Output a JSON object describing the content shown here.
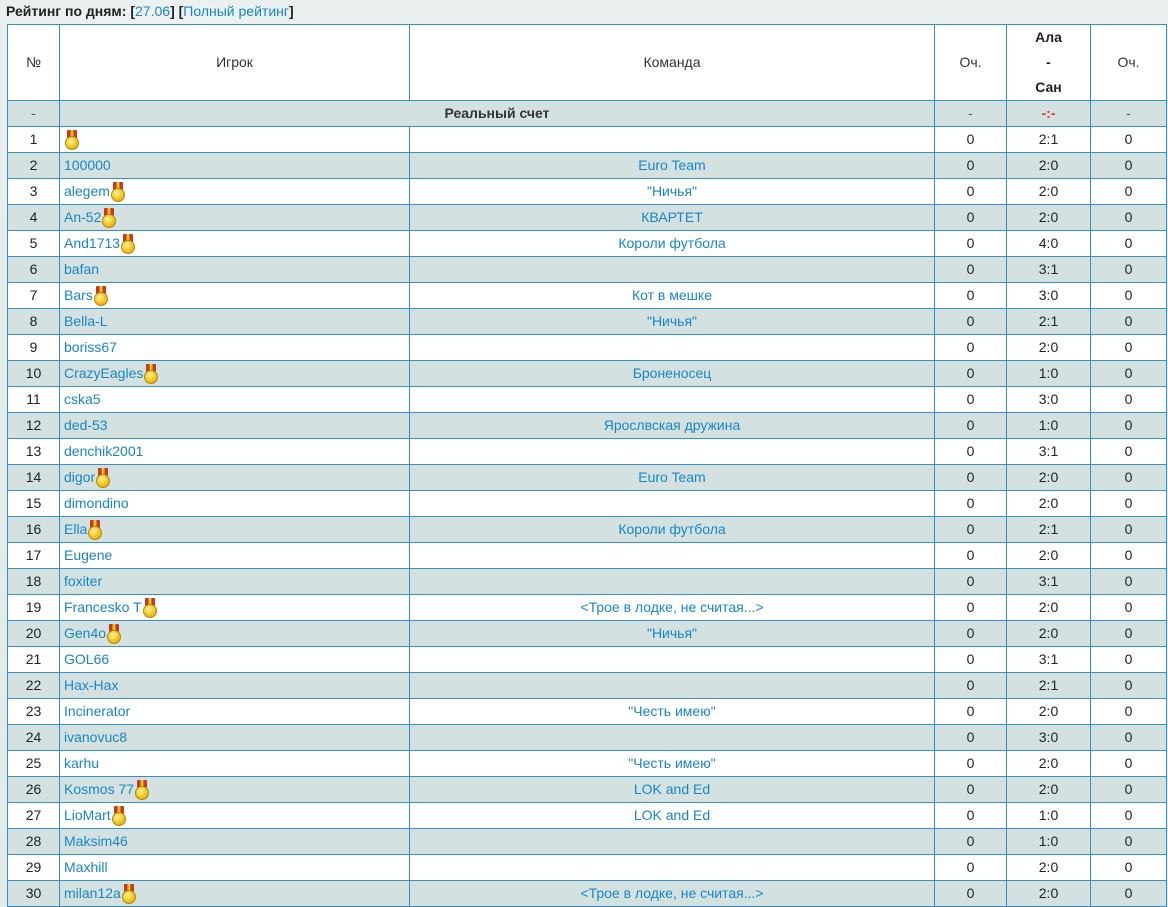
{
  "header": {
    "title": "Рейтинг по дням:",
    "day_link": "27.06",
    "full_link": "Полный рейтинг",
    "open_bracket": "[",
    "close_bracket": "]"
  },
  "table": {
    "columns": {
      "num": "№",
      "player": "Игрок",
      "team": "Команда",
      "points1": "Оч.",
      "match_home": "Ала",
      "match_sep": "-",
      "match_away": "Сан",
      "points2": "Оч."
    },
    "real_row": {
      "num": "-",
      "label": "Реальный счет",
      "points1": "-",
      "score": "-:-",
      "points2": "-"
    },
    "rows": [
      {
        "num": "1",
        "player": "",
        "medal": true,
        "team": "",
        "p1": "0",
        "score": "2:1",
        "p2": "0"
      },
      {
        "num": "2",
        "player": "100000",
        "medal": false,
        "team": "Euro Team",
        "p1": "0",
        "score": "2:0",
        "p2": "0"
      },
      {
        "num": "3",
        "player": "alegem",
        "medal": true,
        "team": "\"Ничья\"",
        "p1": "0",
        "score": "2:0",
        "p2": "0"
      },
      {
        "num": "4",
        "player": "An-52",
        "medal": true,
        "team": "КВАРТЕТ",
        "p1": "0",
        "score": "2:0",
        "p2": "0"
      },
      {
        "num": "5",
        "player": "And1713",
        "medal": true,
        "team": "Короли футбола",
        "p1": "0",
        "score": "4:0",
        "p2": "0"
      },
      {
        "num": "6",
        "player": "bafan",
        "medal": false,
        "team": "",
        "p1": "0",
        "score": "3:1",
        "p2": "0"
      },
      {
        "num": "7",
        "player": "Bars",
        "medal": true,
        "team": "Кот в мешке",
        "p1": "0",
        "score": "3:0",
        "p2": "0"
      },
      {
        "num": "8",
        "player": "Bella-L",
        "medal": false,
        "team": "\"Ничья\"",
        "p1": "0",
        "score": "2:1",
        "p2": "0"
      },
      {
        "num": "9",
        "player": "boriss67",
        "medal": false,
        "team": "",
        "p1": "0",
        "score": "2:0",
        "p2": "0"
      },
      {
        "num": "10",
        "player": "CrazyEagles",
        "medal": true,
        "team": "Броненосец",
        "p1": "0",
        "score": "1:0",
        "p2": "0"
      },
      {
        "num": "11",
        "player": "cska5",
        "medal": false,
        "team": "",
        "p1": "0",
        "score": "3:0",
        "p2": "0"
      },
      {
        "num": "12",
        "player": "ded-53",
        "medal": false,
        "team": "Ярослвская дружина",
        "p1": "0",
        "score": "1:0",
        "p2": "0"
      },
      {
        "num": "13",
        "player": "denchik2001",
        "medal": false,
        "team": "",
        "p1": "0",
        "score": "3:1",
        "p2": "0"
      },
      {
        "num": "14",
        "player": "digor",
        "medal": true,
        "team": "Euro Team",
        "p1": "0",
        "score": "2:0",
        "p2": "0"
      },
      {
        "num": "15",
        "player": "dimondino",
        "medal": false,
        "team": "",
        "p1": "0",
        "score": "2:0",
        "p2": "0"
      },
      {
        "num": "16",
        "player": "Ella",
        "medal": true,
        "team": "Короли футбола",
        "p1": "0",
        "score": "2:1",
        "p2": "0"
      },
      {
        "num": "17",
        "player": "Eugene",
        "medal": false,
        "team": "",
        "p1": "0",
        "score": "2:0",
        "p2": "0"
      },
      {
        "num": "18",
        "player": "foxiter",
        "medal": false,
        "team": "",
        "p1": "0",
        "score": "3:1",
        "p2": "0"
      },
      {
        "num": "19",
        "player": "Francesko T",
        "medal": true,
        "team": "<Трое в лодке, не считая...>",
        "p1": "0",
        "score": "2:0",
        "p2": "0"
      },
      {
        "num": "20",
        "player": "Gen4o",
        "medal": true,
        "team": "\"Ничья\"",
        "p1": "0",
        "score": "2:0",
        "p2": "0"
      },
      {
        "num": "21",
        "player": "GOL66",
        "medal": false,
        "team": "",
        "p1": "0",
        "score": "3:1",
        "p2": "0"
      },
      {
        "num": "22",
        "player": "Hax-Hax",
        "medal": false,
        "team": "",
        "p1": "0",
        "score": "2:1",
        "p2": "0"
      },
      {
        "num": "23",
        "player": "Incinerator",
        "medal": false,
        "team": "\"Честь имею\"",
        "p1": "0",
        "score": "2:0",
        "p2": "0"
      },
      {
        "num": "24",
        "player": "ivanovuc8",
        "medal": false,
        "team": "",
        "p1": "0",
        "score": "3:0",
        "p2": "0"
      },
      {
        "num": "25",
        "player": "karhu",
        "medal": false,
        "team": "\"Честь имею\"",
        "p1": "0",
        "score": "2:0",
        "p2": "0"
      },
      {
        "num": "26",
        "player": "Kosmos 77",
        "medal": true,
        "team": "LOK and Ed",
        "p1": "0",
        "score": "2:0",
        "p2": "0"
      },
      {
        "num": "27",
        "player": "LioMart",
        "medal": true,
        "team": "LOK and Ed",
        "p1": "0",
        "score": "1:0",
        "p2": "0"
      },
      {
        "num": "28",
        "player": "Maksim46",
        "medal": false,
        "team": "",
        "p1": "0",
        "score": "1:0",
        "p2": "0"
      },
      {
        "num": "29",
        "player": "Maxhill",
        "medal": false,
        "team": "",
        "p1": "0",
        "score": "2:0",
        "p2": "0"
      },
      {
        "num": "30",
        "player": "milan12a",
        "medal": true,
        "team": "<Трое в лодке, не считая...>",
        "p1": "0",
        "score": "2:0",
        "p2": "0"
      }
    ]
  },
  "icons": {
    "medal": "medal-icon"
  },
  "colors": {
    "link": "#1a85c6",
    "border": "#3a8fbf",
    "row_alt": "#d3e2e0",
    "real_score": "#e03030"
  }
}
